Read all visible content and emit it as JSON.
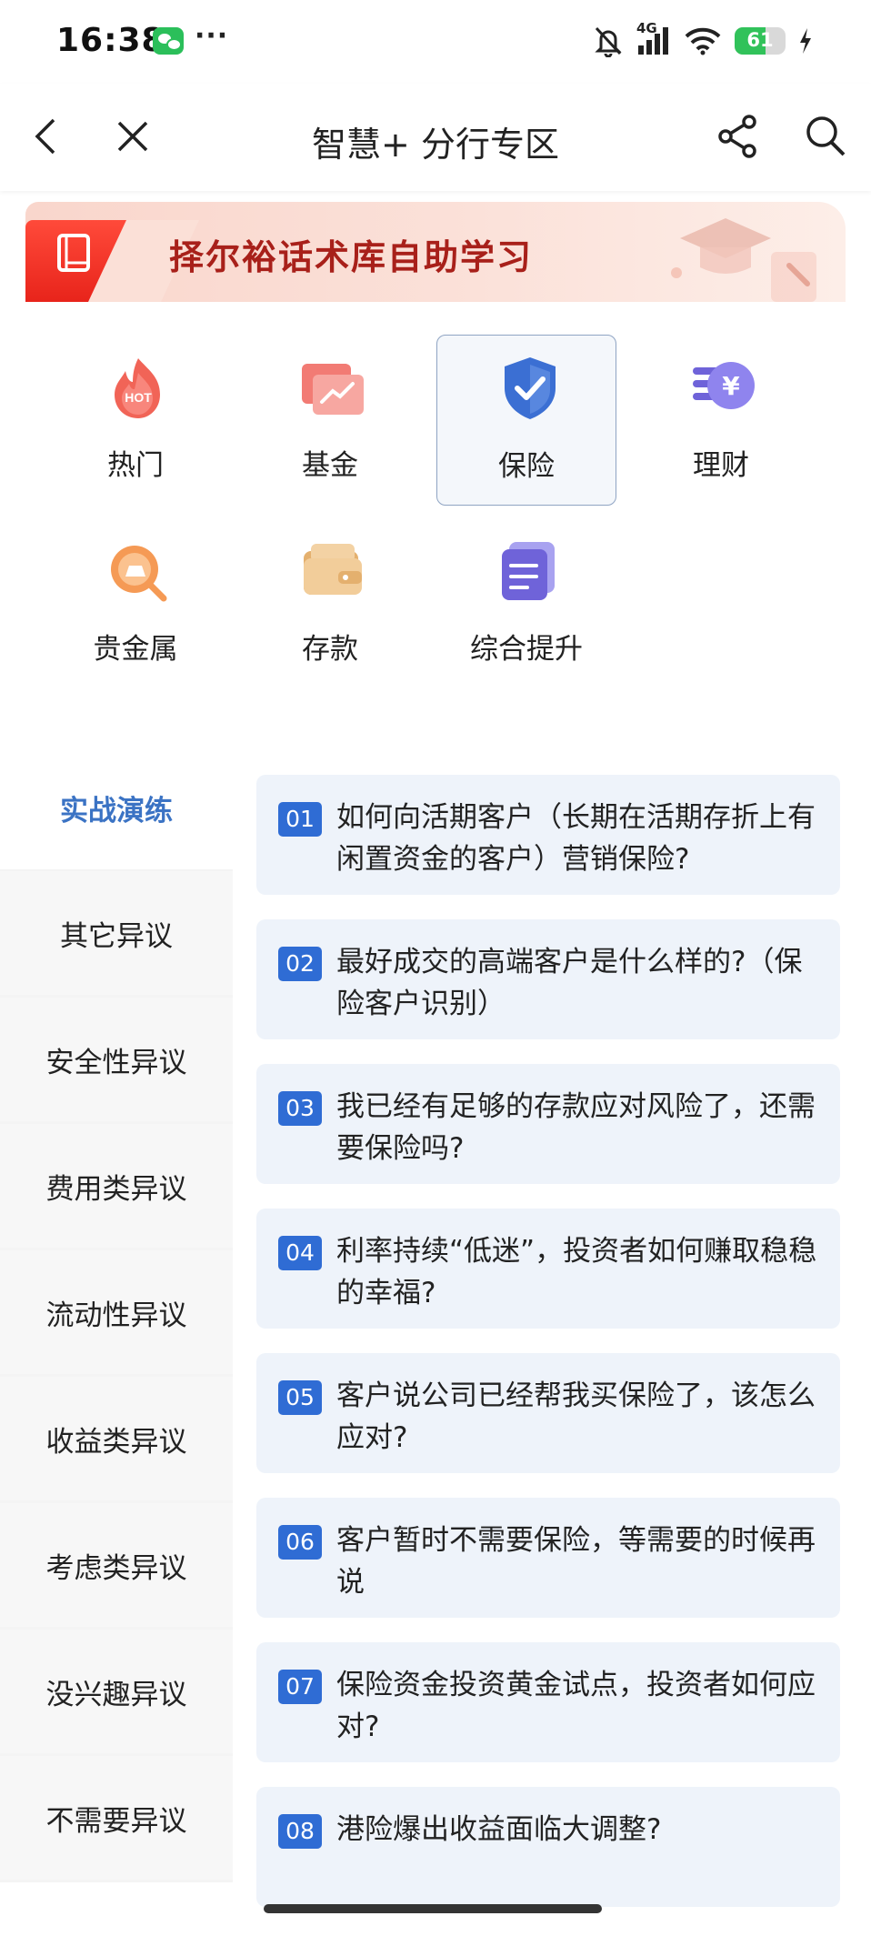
{
  "status_bar": {
    "time": "16:38",
    "more": "···",
    "network": "4G",
    "battery_level": "61",
    "battery_fraction": 0.61,
    "icons": [
      "wechat-icon",
      "mute-bell-icon",
      "signal-icon",
      "wifi-icon",
      "battery-icon",
      "charging-icon"
    ]
  },
  "nav": {
    "title": "智慧+ 分行专区",
    "icons": [
      "back-icon",
      "close-icon",
      "share-icon",
      "search-icon"
    ]
  },
  "banner": {
    "title": "择尔裕话术库自助学习",
    "icons": [
      "book-icon",
      "graduation-cap-icon"
    ]
  },
  "categories": [
    {
      "label": "热门",
      "icon": "hot-fire-icon"
    },
    {
      "label": "基金",
      "icon": "fund-chart-icon"
    },
    {
      "label": "保险",
      "icon": "shield-check-icon",
      "selected": true
    },
    {
      "label": "理财",
      "icon": "yuan-coin-icon"
    },
    {
      "label": "贵金属",
      "icon": "gold-bar-icon"
    },
    {
      "label": "存款",
      "icon": "wallet-icon"
    },
    {
      "label": "综合提升",
      "icon": "document-icon"
    }
  ],
  "sidebar": {
    "items": [
      {
        "label": "实战演练",
        "active": true
      },
      {
        "label": "其它异议"
      },
      {
        "label": "安全性异议"
      },
      {
        "label": "费用类异议"
      },
      {
        "label": "流动性异议"
      },
      {
        "label": "收益类异议"
      },
      {
        "label": "考虑类异议"
      },
      {
        "label": "没兴趣异议"
      },
      {
        "label": "不需要异议"
      }
    ]
  },
  "questions": [
    {
      "num": "01",
      "text": "如何向活期客户（长期在活期存折上有闲置资金的客户）营销保险?"
    },
    {
      "num": "02",
      "text": "最好成交的高端客户是什么样的?（保险客户识别）"
    },
    {
      "num": "03",
      "text": "我已经有足够的存款应对风险了，还需要保险吗?"
    },
    {
      "num": "04",
      "text": "利率持续“低迷”，投资者如何赚取稳稳的幸福?"
    },
    {
      "num": "05",
      "text": "客户说公司已经帮我买保险了，该怎么应对?"
    },
    {
      "num": "06",
      "text": "客户暂时不需要保险，等需要的时候再说"
    },
    {
      "num": "07",
      "text": "保险资金投资黄金试点，投资者如何应对?"
    },
    {
      "num": "08",
      "text": "港险爆出收益面临大调整?"
    }
  ],
  "colors": {
    "accent": "#2f6cd4",
    "active_sidebar": "#3b73c4",
    "banner_red": "#e8241b",
    "banner_text": "#a8201a",
    "card_bg": "#eef3fa"
  }
}
